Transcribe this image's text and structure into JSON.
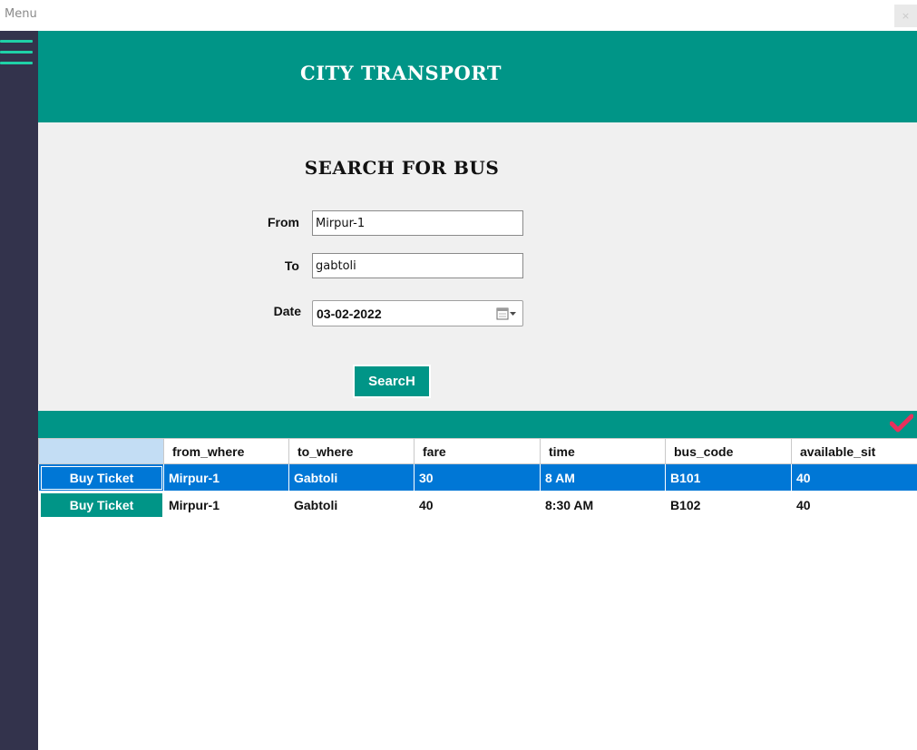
{
  "window": {
    "title": "Menu",
    "close_glyph": "×"
  },
  "sidebar": {
    "menu_icon": "hamburger-menu-icon"
  },
  "header": {
    "app_title": "CITY TRANSPORT"
  },
  "search": {
    "title": "SEARCH FOR BUS",
    "from_label": "From",
    "from_value": "Mirpur-1",
    "to_label": "To",
    "to_value": "gabtoli",
    "date_label": "Date",
    "date_value": "03-02-2022",
    "date_icon": "calendar-dropdown-icon",
    "button_label": "SearcH"
  },
  "results": {
    "status_icon": "checkmark-icon",
    "columns": [
      "",
      "from_where",
      "to_where",
      "fare",
      "time",
      "bus_code",
      "available_sit"
    ],
    "rows": [
      {
        "button": "Buy Ticket",
        "from_where": "Mirpur-1",
        "to_where": "Gabtoli",
        "fare": "30",
        "time": "8 AM",
        "bus_code": "B101",
        "available_sit": "40",
        "selected": true
      },
      {
        "button": "Buy Ticket",
        "from_where": "Mirpur-1",
        "to_where": "Gabtoli",
        "fare": "40",
        "time": "8:30 AM",
        "bus_code": "B102",
        "available_sit": "40",
        "selected": false
      }
    ]
  },
  "colors": {
    "accent": "#009587",
    "sidebar": "#33334c",
    "selection": "#0077d6",
    "menu_lines": "#1fd1a7",
    "check": "#e8305c"
  }
}
